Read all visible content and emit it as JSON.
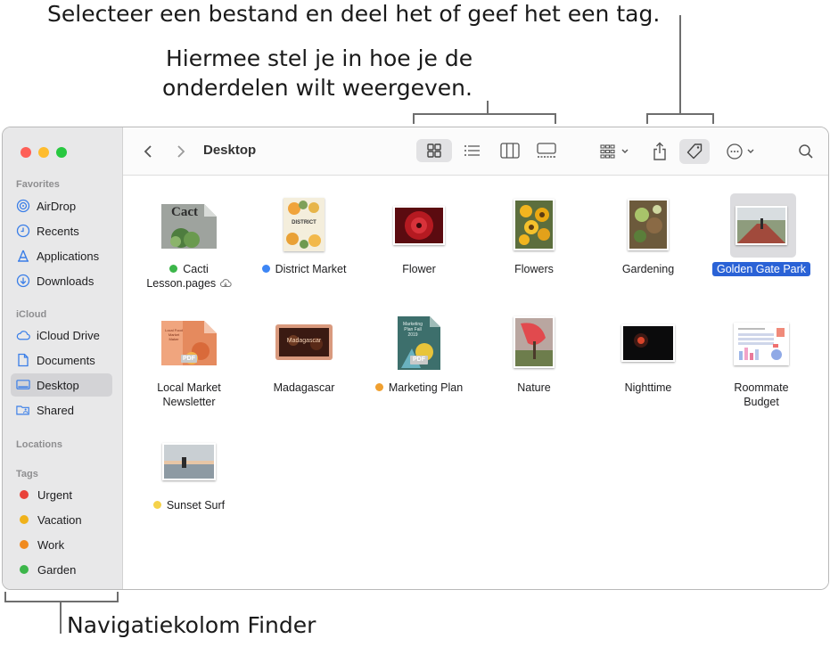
{
  "callouts": {
    "top": "Selecteer een bestand en deel het of geef het een tag.",
    "view_line1": "Hiermee stel je in hoe je de",
    "view_line2": "onderdelen wilt weergeven.",
    "bottom": "Navigatiekolom Finder"
  },
  "window": {
    "title": "Desktop"
  },
  "sidebar": {
    "favorites_header": "Favorites",
    "favorites": [
      {
        "label": "AirDrop",
        "icon": "airdrop-icon"
      },
      {
        "label": "Recents",
        "icon": "clock-icon"
      },
      {
        "label": "Applications",
        "icon": "applications-icon"
      },
      {
        "label": "Downloads",
        "icon": "download-icon"
      }
    ],
    "icloud_header": "iCloud",
    "icloud": [
      {
        "label": "iCloud Drive",
        "icon": "cloud-icon"
      },
      {
        "label": "Documents",
        "icon": "document-icon"
      },
      {
        "label": "Desktop",
        "icon": "desktop-icon"
      },
      {
        "label": "Shared",
        "icon": "shared-folder-icon"
      }
    ],
    "locations_header": "Locations",
    "tags_header": "Tags",
    "tags": [
      {
        "label": "Urgent",
        "color": "#e9423a"
      },
      {
        "label": "Vacation",
        "color": "#f0b21b"
      },
      {
        "label": "Work",
        "color": "#f08a1f"
      },
      {
        "label": "Garden",
        "color": "#3cb64a"
      }
    ]
  },
  "files": [
    {
      "name1": "Cacti",
      "name2": "Lesson.pages",
      "dot": "#3cb64a",
      "icloud": true
    },
    {
      "name1": "District Market",
      "dot": "#3d86f5"
    },
    {
      "name1": "Flower"
    },
    {
      "name1": "Flowers"
    },
    {
      "name1": "Gardening"
    },
    {
      "name1": "Golden Gate Park",
      "selected": true
    },
    {
      "name1": "Local Market",
      "name2": "Newsletter"
    },
    {
      "name1": "Madagascar"
    },
    {
      "name1": "Marketing Plan",
      "dot": "#f0a030"
    },
    {
      "name1": "Nature"
    },
    {
      "name1": "Nighttime"
    },
    {
      "name1": "Roommate",
      "name2": "Budget"
    },
    {
      "name1": "Sunset Surf",
      "dot": "#f5d24a"
    }
  ],
  "thumbs": {
    "cacti_title": "Cact",
    "district_title": "DISTRICT",
    "pdf_badge": "PDF",
    "marketing_text": "Marketing Plan Fall 2019",
    "madagascar_text": "Madagascar",
    "local_market_text": "Local Food Market Maker"
  },
  "colors": {
    "accent": "#2a62d6",
    "sidebar_bg": "#e8e8e9"
  }
}
